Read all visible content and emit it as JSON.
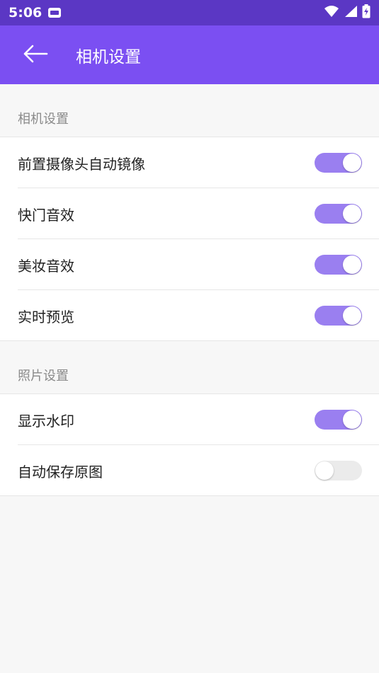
{
  "status_bar": {
    "time": "5:06",
    "icons": [
      "notification-icon",
      "wifi-icon",
      "signal-icon",
      "battery-charging-icon"
    ]
  },
  "app_bar": {
    "title": "相机设置",
    "back_icon": "arrow-left-icon"
  },
  "sections": [
    {
      "header": "相机设置",
      "items": [
        {
          "label": "前置摄像头自动镜像",
          "on": true
        },
        {
          "label": "快门音效",
          "on": true
        },
        {
          "label": "美妆音效",
          "on": true
        },
        {
          "label": "实时预览",
          "on": true
        }
      ]
    },
    {
      "header": "照片设置",
      "items": [
        {
          "label": "显示水印",
          "on": true
        },
        {
          "label": "自动保存原图",
          "on": false
        }
      ]
    }
  ],
  "colors": {
    "status_bar": "#5b37c4",
    "app_bar": "#7b4ff2",
    "switch_on": "#9a7ff0",
    "switch_off": "#ebebeb"
  }
}
